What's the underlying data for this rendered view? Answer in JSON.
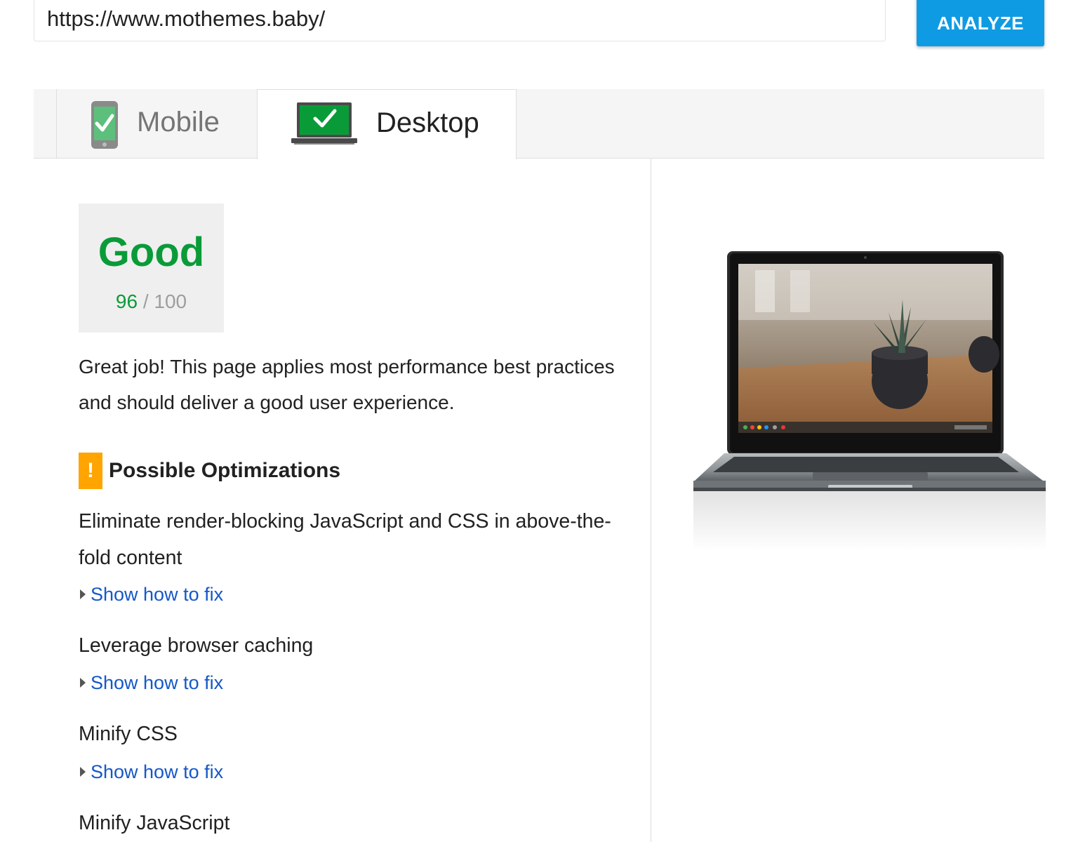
{
  "search": {
    "url": "https://www.mothemes.baby/",
    "analyze_label": "ANALYZE"
  },
  "tabs": [
    {
      "label": "Mobile",
      "icon": "mobile-check-icon",
      "active": false
    },
    {
      "label": "Desktop",
      "icon": "desktop-check-icon",
      "active": true
    }
  ],
  "score": {
    "rating": "Good",
    "value": "96",
    "separator": "/",
    "max": "100"
  },
  "summary": "Great job! This page applies most performance best practices and should deliver a good user experience.",
  "optimizations": {
    "badge": "!",
    "title": "Possible Optimizations",
    "items": [
      {
        "title": "Eliminate render-blocking JavaScript and CSS in above-the-fold content",
        "fix_label": "Show how to fix"
      },
      {
        "title": "Leverage browser caching",
        "fix_label": "Show how to fix"
      },
      {
        "title": "Minify CSS",
        "fix_label": "Show how to fix"
      },
      {
        "title": "Minify JavaScript"
      }
    ]
  },
  "colors": {
    "accent": "#0f9be3",
    "good": "#0a9b39",
    "warning": "#ffa400",
    "link": "#1558c7"
  }
}
